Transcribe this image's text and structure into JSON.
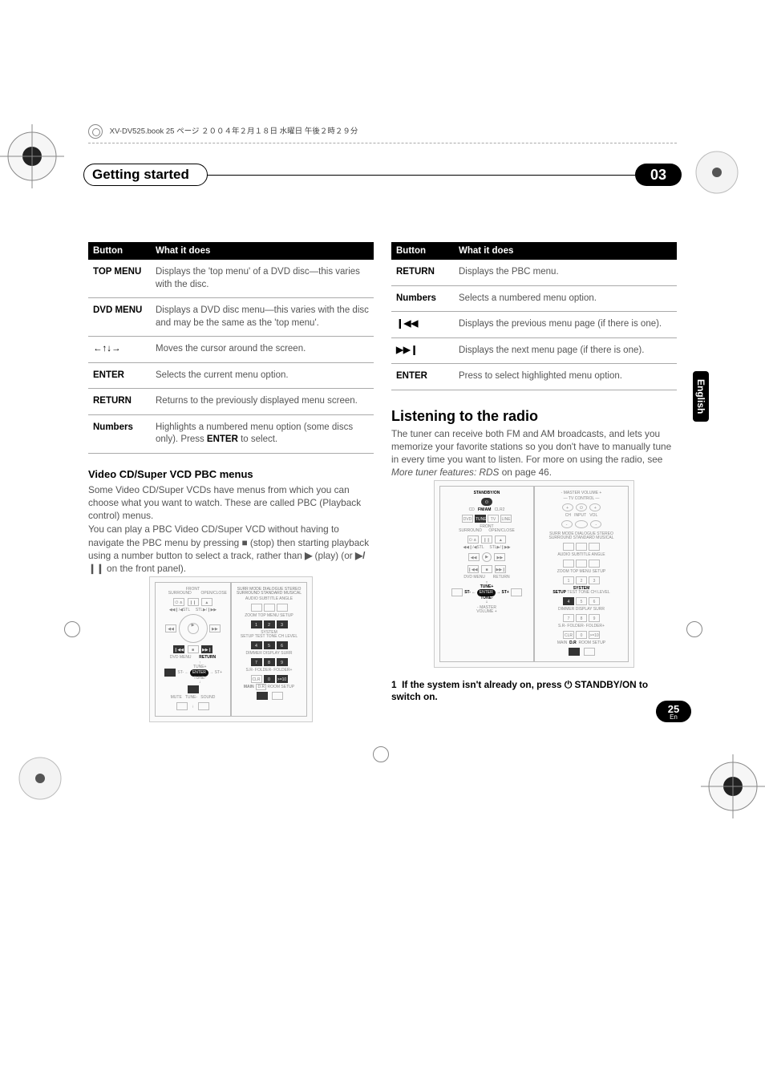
{
  "header_note": "XV-DV525.book 25 ページ ２００４年２月１８日 水曜日 午後２時２９分",
  "titlebar": {
    "left": "Getting started",
    "right": "03"
  },
  "lang_tab": "English",
  "table1": {
    "head_button": "Button",
    "head_what": "What it does",
    "rows": [
      {
        "b": "TOP MENU",
        "d": "Displays the 'top menu' of a DVD disc—this varies with the disc."
      },
      {
        "b": "DVD MENU",
        "d": "Displays a DVD disc menu—this varies with the disc and may be the same as the 'top menu'."
      },
      {
        "b": "←↑↓→",
        "d": "Moves the cursor around the screen.",
        "arrow": true
      },
      {
        "b": "ENTER",
        "d": "Selects the current menu option."
      },
      {
        "b": "RETURN",
        "d": "Returns to the previously displayed menu screen."
      },
      {
        "b": "Numbers",
        "d": "Highlights a numbered menu option (some discs only). Press <b>ENTER</b> to select."
      }
    ]
  },
  "subhead1": "Video CD/Super VCD PBC menus",
  "para1": "Some Video CD/Super VCDs have menus from which you can choose what you want to watch. These are called PBC (Playback control) menus.",
  "para2_pre": "You can play a PBC Video CD/Super VCD without having to navigate the PBC menu by pressing ",
  "para2_stop": "■",
  "para2_mid": " (stop) then starting playback using a number button to select a track, rather than ",
  "para2_play": "▶",
  "para2_after": " (play) (or ",
  "para2_playpause": "▶/❙❙",
  "para2_end": " on the front panel).",
  "table2": {
    "head_button": "Button",
    "head_what": "What it does",
    "rows": [
      {
        "b": "RETURN",
        "d": "Displays the PBC menu."
      },
      {
        "b": "Numbers",
        "d": "Selects a numbered menu option."
      },
      {
        "b": "❙◀◀",
        "d": "Displays the previous menu page (if there is one).",
        "sym": true
      },
      {
        "b": "▶▶❙",
        "d": "Displays the next menu page (if there is one).",
        "sym": true
      },
      {
        "b": "ENTER",
        "d": "Press to select highlighted menu option."
      }
    ]
  },
  "h2": "Listening to the radio",
  "para3_a": "The tuner can receive both FM and AM broadcasts, and lets you memorize your favorite stations so you don't have to manually tune in every time you want to listen. For more on using the radio, see ",
  "para3_em": "More tuner features: RDS",
  "para3_b": " on page 46.",
  "step1_num": "1",
  "step1_a": "If the system isn't already on, press ",
  "step1_sym": "⏻",
  "step1_b": " STANDBY/ON to switch on.",
  "footer": {
    "page": "25",
    "lang": "En"
  },
  "remote": {
    "labels": [
      "STANDBY/ON",
      "CD",
      "FM/AM",
      "CLR2",
      "DVD",
      "TUNER",
      "TV",
      "LINE",
      "FRONT SURROUND",
      "OPEN/CLOSE",
      "DVD MENU",
      "RETURN",
      "TUNE+",
      "TUNE-",
      "ST-",
      "ST+",
      "ENTER",
      "MUTE",
      "SOUND",
      "MASTER VOLUME",
      "TV CONTROL",
      "CH",
      "INPUT",
      "VOL",
      "AUDIO",
      "SUBTITLE",
      "ANGLE",
      "TOP MENU",
      "ZOOM",
      "SYSTEM SETUP",
      "TEST TONE",
      "CH LEVEL",
      "DIMMER",
      "DISPLAY",
      "SURR SETUP",
      "CLR",
      "FOLDER-",
      "FOLDER+",
      "MAIN",
      "LINE",
      "ROOM SETUP",
      "D.R",
      "1",
      "2",
      "3",
      "4",
      "5",
      "6",
      "7",
      "8",
      "9",
      "0"
    ]
  }
}
